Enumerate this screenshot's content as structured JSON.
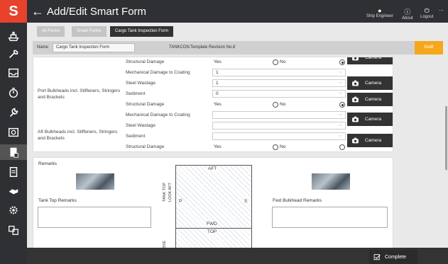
{
  "app": {
    "logo": "S",
    "title": "Add/Edit Smart Form"
  },
  "header_buttons": [
    {
      "label": "Ship Engineer",
      "icon": "user-icon"
    },
    {
      "label": "About",
      "icon": "info-icon"
    },
    {
      "label": "Logout",
      "icon": "logout-icon"
    }
  ],
  "more_label": "...",
  "tabs": [
    {
      "label": "All Forms"
    },
    {
      "label": "Smart Forms"
    },
    {
      "label": "Cargo Tank Inspection Form"
    }
  ],
  "namebar": {
    "name_label": "Name",
    "name_value": "Cargo Tank Inspection Form",
    "code": "TANKCON",
    "revision": "Template Revision No.8",
    "status": "Draft"
  },
  "inspection": {
    "groups": [
      {
        "title": "Port Bulkheads incl. Stiffeners, Stringers and Brackets"
      },
      {
        "title": "Aft Bulkheads incl. Stiffeners, Stringers and Brackets"
      }
    ],
    "rows": [
      {
        "label": "Structural Damage",
        "type": "yesno",
        "yes_label": "Yes",
        "no_label": "No"
      },
      {
        "label": "Mechanical Damage to Coating",
        "type": "select",
        "value": "1"
      },
      {
        "label": "Steel Wastage",
        "type": "select",
        "value": "1"
      },
      {
        "label": "Sediment",
        "type": "select",
        "value": "0"
      },
      {
        "label": "Structural Damage",
        "type": "yesno",
        "yes_label": "Yes",
        "no_label": "No"
      },
      {
        "label": "Mechanical Damage to Coating",
        "type": "select",
        "value": ""
      },
      {
        "label": "Steel Wastage",
        "type": "select",
        "value": ""
      },
      {
        "label": "Sediment",
        "type": "select",
        "value": ""
      },
      {
        "label": "Structural Damage",
        "type": "yesno",
        "yes_label": "Yes",
        "no_label": "No"
      }
    ],
    "camera_label": "Camera"
  },
  "remarks": {
    "title": "Remarks",
    "left_label": "Tank Top Remarks",
    "right_label": "Fwd Bulkhead Remarks",
    "tank_labels": {
      "aft": "AFT",
      "p": "P",
      "s": "S",
      "fwd": "FWD",
      "top": "TOP",
      "side1": "TANK TOP",
      "side2": "LOOK AFT",
      "side3": "BSE"
    }
  },
  "footer": {
    "complete_label": "Complete"
  },
  "colors": {
    "accent": "#e8412c",
    "draft": "#f5a81c",
    "dark": "#2f3033"
  }
}
